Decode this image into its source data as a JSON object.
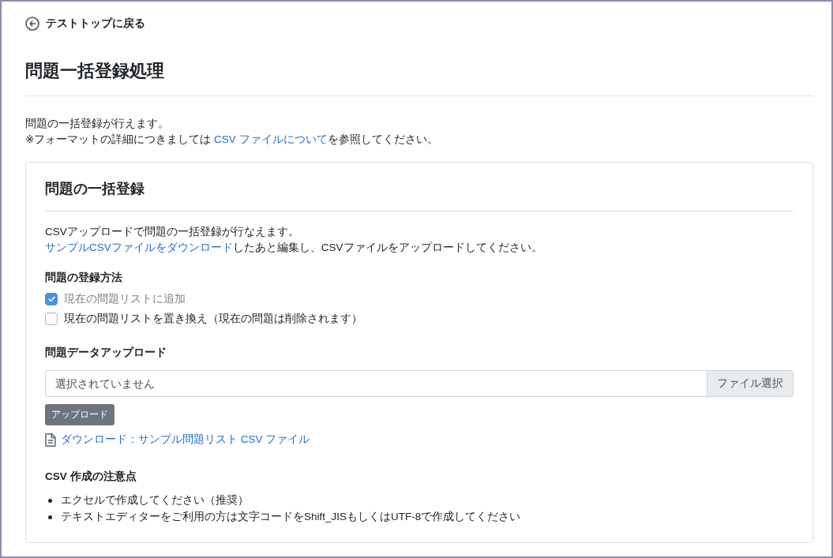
{
  "back_link": {
    "label": "テストトップに戻る"
  },
  "page_title": "問題一括登録処理",
  "intro": {
    "line_1": "問題の一括登録が行えます。",
    "line_2": {
      "before": "※フォーマットの詳細につきましては ",
      "link": "CSV ファイルについて",
      "after": "を参照してください。"
    }
  },
  "card": {
    "title": "問題の一括登録",
    "description": {
      "line_1": "CSVアップロードで問題の一括登録が行なえます。",
      "line_2": {
        "link": "サンプルCSVファイルをダウンロード",
        "after": "したあと編集し、CSVファイルをアップロードしてください。"
      }
    },
    "method": {
      "label": "問題の登録方法",
      "options": [
        {
          "label": "現在の問題リストに追加",
          "checked": true,
          "disabled": true
        },
        {
          "label": "現在の問題リストを置き換え（現在の問題は削除されます）",
          "checked": false,
          "disabled": false
        }
      ]
    },
    "upload": {
      "label": "問題データアップロード",
      "file_field": {
        "placeholder": "選択されていません",
        "browse_button": "ファイル選択"
      },
      "upload_button": "アップロード",
      "download_link": "ダウンロード：サンプル問題リスト CSV ファイル"
    },
    "notes": {
      "title": "CSV 作成の注意点",
      "items": [
        "エクセルで作成してください（推奨）",
        "テキストエディターをご利用の方は文字コードをShift_JISもしくはUTF-8で作成してください"
      ]
    }
  }
}
